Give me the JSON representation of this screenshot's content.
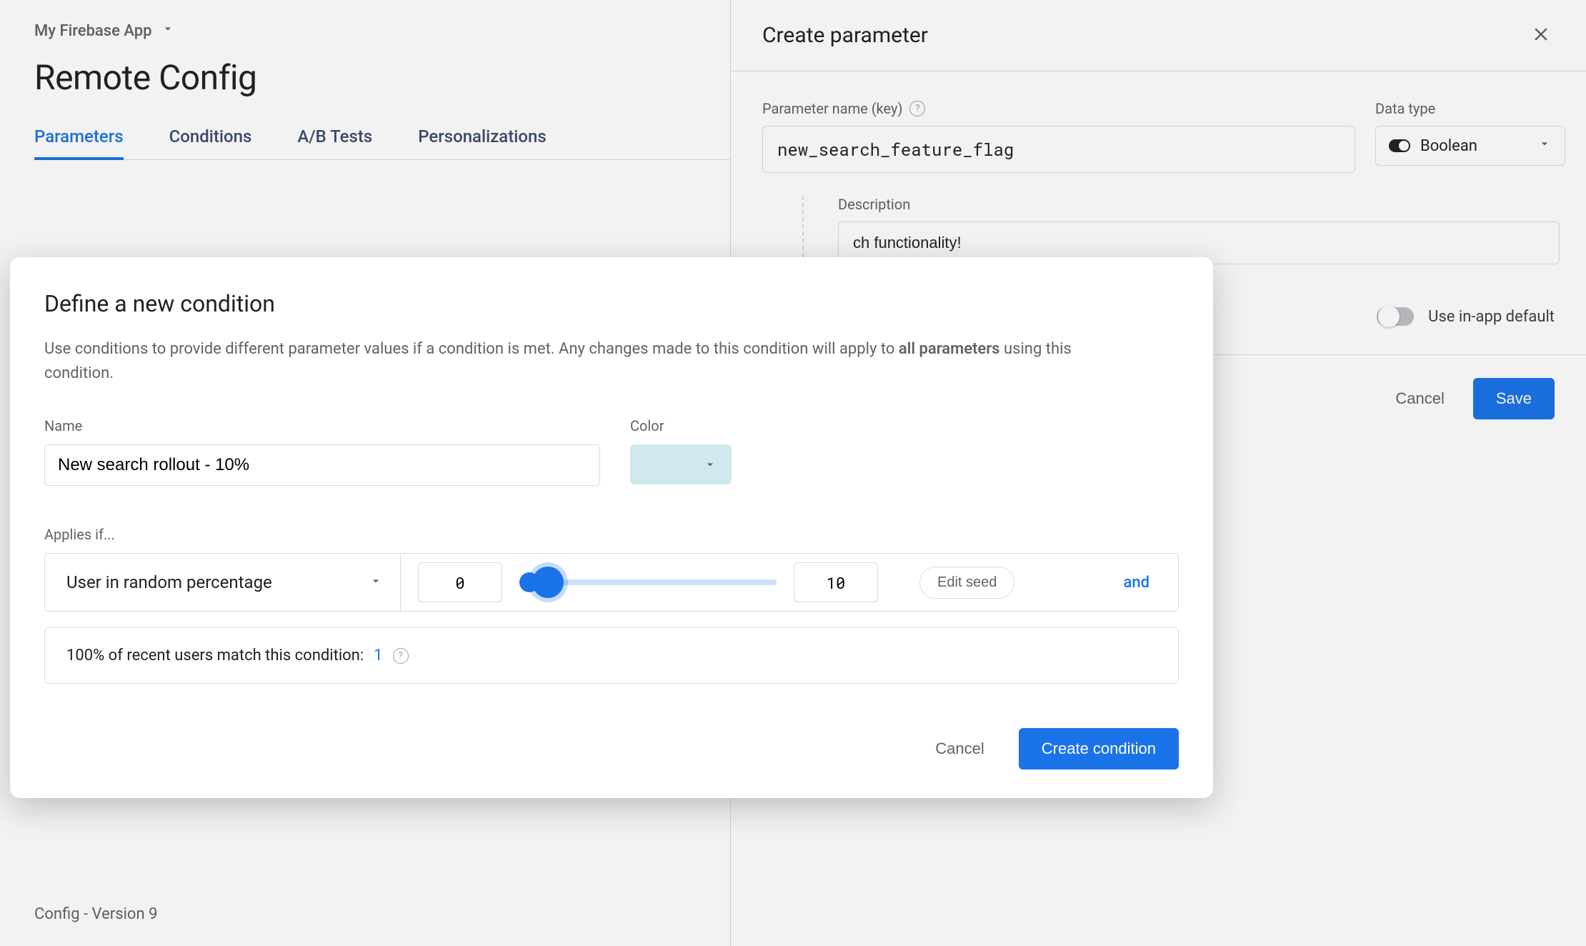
{
  "header": {
    "app_name": "My Firebase App",
    "page_title": "Remote Config"
  },
  "tabs": {
    "parameters": "Parameters",
    "conditions": "Conditions",
    "abtests": "A/B Tests",
    "personalizations": "Personalizations"
  },
  "drawer": {
    "title": "Create parameter",
    "param_key_label": "Parameter name (key)",
    "param_key_value": "new_search_feature_flag",
    "data_type_label": "Data type",
    "data_type_value": "Boolean",
    "description_label": "Description",
    "description_value_tail": "ch functionality!",
    "use_in_app_default": "Use in-app default",
    "cancel": "Cancel",
    "save": "Save"
  },
  "dialog": {
    "title": "Define a new condition",
    "subtitle_pre": "Use conditions to provide different parameter values if a condition is met. Any changes made to this condition will apply to ",
    "subtitle_bold": "all parameters",
    "subtitle_post": " using this condition.",
    "name_label": "Name",
    "name_value": "New search rollout - 10%",
    "color_label": "Color",
    "color_value": "#cfe9ec",
    "applies_if": "Applies if...",
    "rule_type": "User in random percentage",
    "range_min": "0",
    "range_max": "10",
    "edit_seed": "Edit seed",
    "and": "and",
    "match_text_pre": "100% of recent users match this condition: ",
    "match_count": "1",
    "cancel": "Cancel",
    "create": "Create condition"
  },
  "footer": {
    "version": "Config - Version 9"
  }
}
